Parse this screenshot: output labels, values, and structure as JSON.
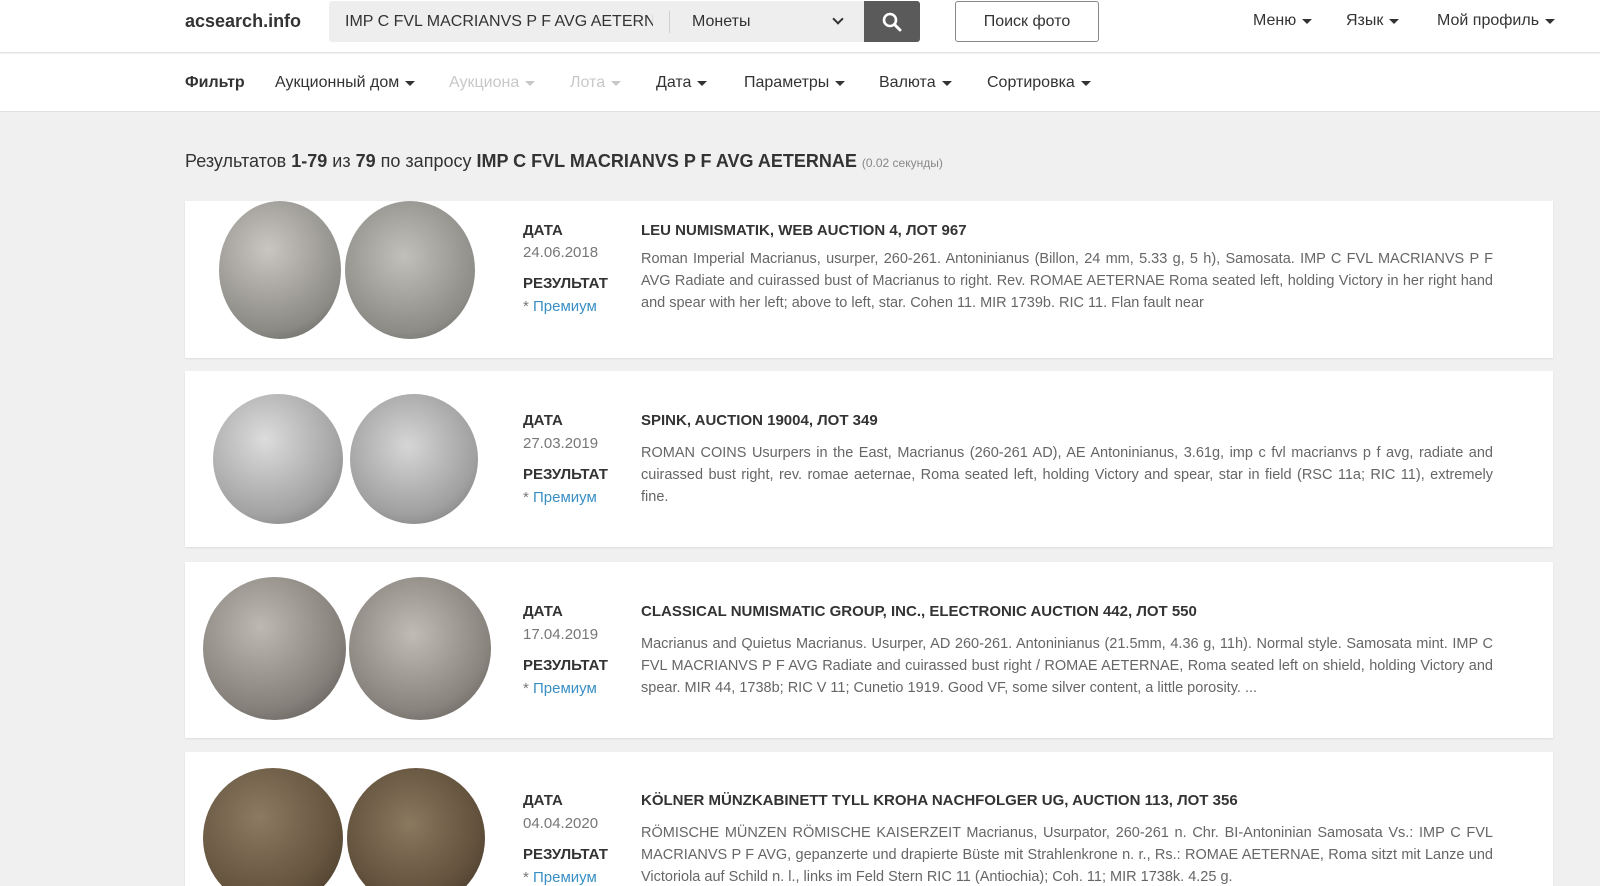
{
  "header": {
    "brand": "acsearch.info",
    "search_value": "IMP C FVL MACRIANVS P F AVG AETERNAE",
    "category": "Монеты",
    "photo_search": "Поиск фото",
    "nav": {
      "menu": "Меню",
      "language": "Язык",
      "profile": "Мой профиль"
    },
    "icons": {
      "search": "search-icon",
      "dropdown": "chevron-down-icon"
    }
  },
  "filters": {
    "label": "Фильтр",
    "auction_house": "Аукционный дом",
    "auction": "Аукциона",
    "lot": "Лота",
    "date": "Дата",
    "params": "Параметры",
    "currency": "Валюта",
    "sort": "Сортировка"
  },
  "summary": {
    "prefix": "Результатов",
    "range": "1-79",
    "of": "из",
    "total": "79",
    "query_prefix": "по запросу",
    "query": "IMP C FVL MACRIANVS P F AVG AETERNAE",
    "time": "(0.02 секунды)"
  },
  "results": [
    {
      "date_label": "ДАТА",
      "date": "24.06.2018",
      "result_label": "РЕЗУЛЬТАТ",
      "premium": "Премиум",
      "title": "LEU NUMISMATIK, WEB AUCTION 4, ЛОТ 967",
      "description": "Roman Imperial Macrianus, usurper, 260-261. Antoninianus (Billon, 24 mm, 5.33 g, 5 h), Samosata. IMP C FVL MACRIANVS P F AVG Radiate and cuirassed bust of Macrianus to right. Rev. ROMAE AETERNAE Roma seated left, holding Victory in her right hand and spear with her left; above to left, star. Cohen 11. MIR 1739b. RIC 11. Flan fault near"
    },
    {
      "date_label": "ДАТА",
      "date": "27.03.2019",
      "result_label": "РЕЗУЛЬТАТ",
      "premium": "Премиум",
      "title": "SPINK, AUCTION 19004, ЛОТ 349",
      "description": "ROMAN COINS Usurpers in the East, Macrianus (260-261 AD), AE Antoninianus, 3.61g, imp c fvl macrianvs p f avg, radiate and cuirassed bust right, rev. romae aeternae, Roma seated left, holding Victory and spear, star in field (RSC 11a; RIC 11), extremely fine."
    },
    {
      "date_label": "ДАТА",
      "date": "17.04.2019",
      "result_label": "РЕЗУЛЬТАТ",
      "premium": "Премиум",
      "title": "CLASSICAL NUMISMATIC GROUP, INC., ELECTRONIC AUCTION 442, ЛОТ 550",
      "description": "Macrianus and Quietus Macrianus. Usurper, AD 260-261. Antoninianus (21.5mm, 4.36 g, 11h). Normal style. Samosata mint. IMP C FVL MACRIANVS P F AVG Radiate and cuirassed bust right / ROMAE AETERNAE, Roma seated left on shield, holding Victory and spear. MIR 44, 1738b; RIC V 11; Cunetio 1919. Good VF, some silver content, a little porosity. ..."
    },
    {
      "date_label": "ДАТА",
      "date": "04.04.2020",
      "result_label": "РЕЗУЛЬТАТ",
      "premium": "Премиум",
      "title": "KÖLNER MÜNZKABINETT TYLL KROHA NACHFOLGER UG, AUCTION 113, ЛОТ 356",
      "description": "RÖMISCHE MÜNZEN RÖMISCHE KAISERZEIT Macrianus, Usurpator, 260-261 n. Chr. BI-Antoninian Samosata Vs.: IMP C FVL MACRIANVS P F AVG, gepanzerte und drapierte Büste mit Strahlenkrone n. r., Rs.: ROMAE AETERNAE, Roma sitzt mit Lanze und Victoriola auf Schild n. l., links im Feld Stern RIC 11 (Antiochia); Coh. 11; MIR 1738k. 4.25 g."
    }
  ],
  "colors": {
    "link": "#3a8fc4",
    "search_button": "#5a5a5a",
    "page_background": "#f0f0f0",
    "coin_silver": "#a8a8a8",
    "coin_bronze": "#6b5a45"
  }
}
